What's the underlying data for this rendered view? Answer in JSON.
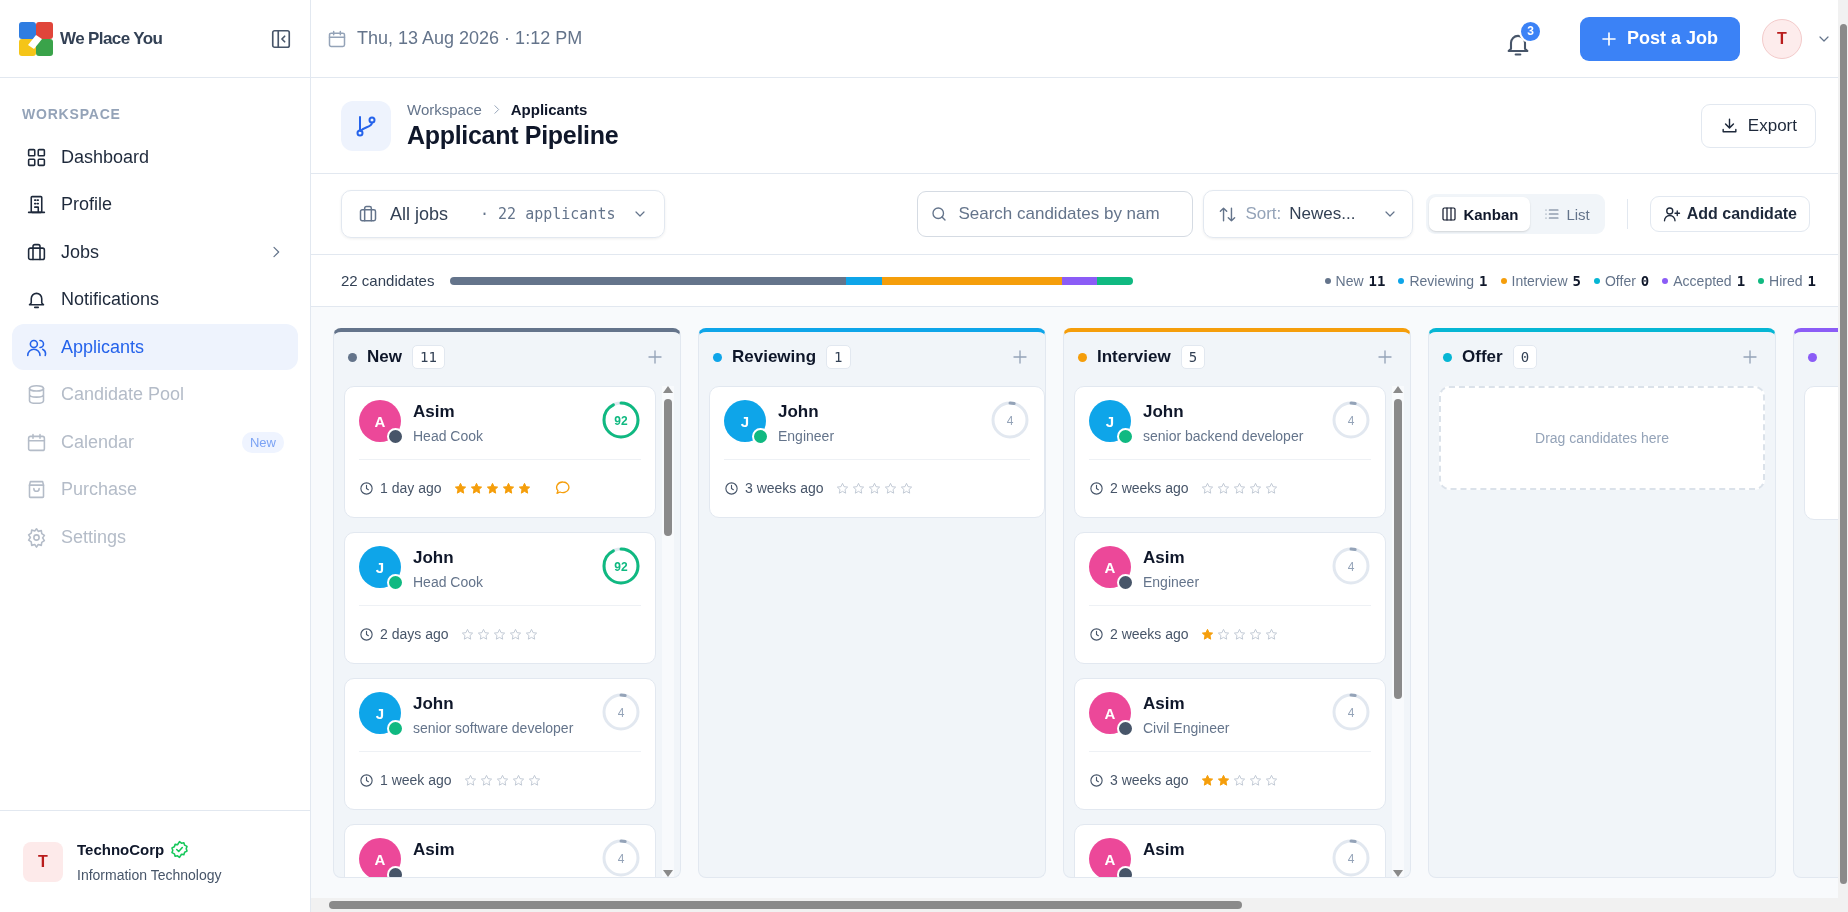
{
  "sidebar": {
    "brand": "We Place You",
    "section": "WORKSPACE",
    "items": [
      {
        "label": "Dashboard",
        "selected": false,
        "disabled": false,
        "expandable": false
      },
      {
        "label": "Profile",
        "selected": false,
        "disabled": false,
        "expandable": false
      },
      {
        "label": "Jobs",
        "selected": false,
        "disabled": false,
        "expandable": true
      },
      {
        "label": "Notifications",
        "selected": false,
        "disabled": false,
        "expandable": false
      },
      {
        "label": "Applicants",
        "selected": true,
        "disabled": false,
        "expandable": false
      },
      {
        "label": "Candidate Pool",
        "selected": false,
        "disabled": true,
        "expandable": false
      },
      {
        "label": "Calendar",
        "selected": false,
        "disabled": true,
        "expandable": false,
        "badge": "New"
      },
      {
        "label": "Purchase",
        "selected": false,
        "disabled": true,
        "expandable": false
      },
      {
        "label": "Settings",
        "selected": false,
        "disabled": true,
        "expandable": false
      }
    ],
    "org": {
      "initial": "T",
      "name": "TechnoCorp",
      "verified": true,
      "industry": "Information Technology"
    }
  },
  "topbar": {
    "datetime": "Thu, 13 Aug 2026 · 1:12 PM",
    "notification_count": "3",
    "post_button": "Post a Job",
    "user_initial": "T"
  },
  "page": {
    "breadcrumb": [
      "Workspace",
      "Applicants"
    ],
    "title": "Applicant Pipeline",
    "export_button": "Export"
  },
  "toolbar": {
    "job_filter": "All jobs",
    "job_count": "· 22 applicants",
    "search": {
      "placeholder": "Search candidates by nam"
    },
    "sort_label": "Sort:",
    "sort_value": "Newes...",
    "views": [
      {
        "label": "Kanban",
        "selected": true
      },
      {
        "label": "List",
        "selected": false
      }
    ],
    "add_button": "Add candidate"
  },
  "pipeline": {
    "total": "22 candidates",
    "legend": [
      {
        "label": "New",
        "count": "11",
        "color": "#64748b"
      },
      {
        "label": "Reviewing",
        "count": "1",
        "color": "#0ea5e9"
      },
      {
        "label": "Interview",
        "count": "5",
        "color": "#f59e0b"
      },
      {
        "label": "Offer",
        "count": "0",
        "color": "#06b6d4"
      },
      {
        "label": "Accepted",
        "count": "1",
        "color": "#8b5cf6"
      },
      {
        "label": "Hired",
        "count": "1",
        "color": "#10b981"
      }
    ]
  },
  "columns": [
    {
      "title": "New",
      "count": "11",
      "color": "#64748b",
      "cards": [
        {
          "avatar": {
            "initial": "A",
            "color": "#ec4899"
          },
          "status": {
            "color": "#475569"
          },
          "name": "Asim",
          "role": "Head Cook",
          "score": "92",
          "time": "1 day ago",
          "stars": 5,
          "has_comment": true
        },
        {
          "avatar": {
            "initial": "J",
            "color": "#0ea5e9"
          },
          "status": {
            "color": "#10b981"
          },
          "name": "John",
          "role": "Head Cook",
          "score": "92",
          "time": "2 days ago",
          "stars": 0,
          "has_comment": false
        },
        {
          "avatar": {
            "initial": "J",
            "color": "#0ea5e9"
          },
          "status": {
            "color": "#10b981"
          },
          "name": "John",
          "role": "senior software developer",
          "score": "4",
          "time": "1 week ago",
          "stars": 0,
          "has_comment": false
        },
        {
          "avatar": {
            "initial": "A",
            "color": "#ec4899"
          },
          "status": {
            "color": "#475569"
          },
          "name": "Asim",
          "score": "4"
        }
      ]
    },
    {
      "title": "Reviewing",
      "count": "1",
      "color": "#0ea5e9",
      "cards": [
        {
          "avatar": {
            "initial": "J",
            "color": "#0ea5e9"
          },
          "status": {
            "color": "#10b981"
          },
          "name": "John",
          "role": "Engineer",
          "score": "4",
          "time": "3 weeks ago",
          "stars": 0,
          "has_comment": false
        }
      ]
    },
    {
      "title": "Interview",
      "count": "5",
      "color": "#f59e0b",
      "cards": [
        {
          "avatar": {
            "initial": "J",
            "color": "#0ea5e9"
          },
          "status": {
            "color": "#10b981"
          },
          "name": "John",
          "role": "senior backend developer",
          "score": "4",
          "time": "2 weeks ago",
          "stars": 0,
          "has_comment": false
        },
        {
          "avatar": {
            "initial": "A",
            "color": "#ec4899"
          },
          "status": {
            "color": "#475569"
          },
          "name": "Asim",
          "role": "Engineer",
          "score": "4",
          "time": "2 weeks ago",
          "stars": 1,
          "has_comment": false
        },
        {
          "avatar": {
            "initial": "A",
            "color": "#ec4899"
          },
          "status": {
            "color": "#475569"
          },
          "name": "Asim",
          "role": "Civil Engineer",
          "score": "4",
          "time": "3 weeks ago",
          "stars": 2,
          "has_comment": false
        },
        {
          "avatar": {
            "initial": "A",
            "color": "#ec4899"
          },
          "status": {
            "color": "#475569"
          },
          "name": "Asim",
          "score": "4"
        }
      ]
    },
    {
      "title": "Offer",
      "count": "0",
      "color": "#06b6d4",
      "empty_text": "Drag candidates here"
    },
    {
      "color": "#8b5cf6"
    }
  ]
}
